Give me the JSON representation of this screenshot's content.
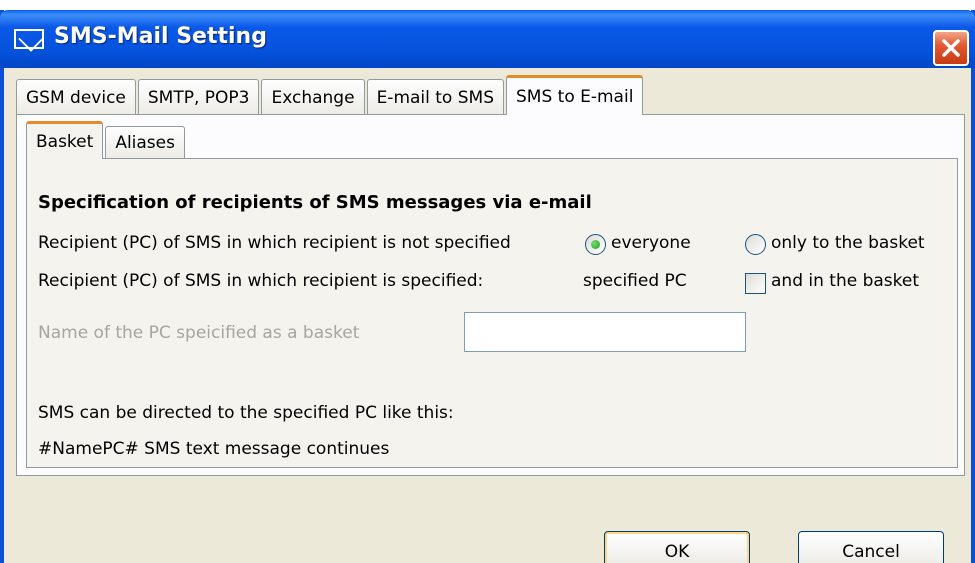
{
  "window": {
    "title": "SMS-Mail Setting",
    "accent_color": "#0a58e8",
    "title_icon": "envelope-icon",
    "close_icon": "close-icon"
  },
  "main_tabs": [
    {
      "label": "GSM device"
    },
    {
      "label": "SMTP, POP3"
    },
    {
      "label": "Exchange"
    },
    {
      "label": "E-mail to SMS"
    },
    {
      "label": "SMS to E-mail",
      "selected": true
    }
  ],
  "sub_tabs": [
    {
      "label": "Basket",
      "selected": true
    },
    {
      "label": "Aliases"
    }
  ],
  "basket": {
    "heading": "Specification of recipients of SMS messages via e-mail",
    "row1_label": "Recipient (PC) of SMS in which recipient is not specified",
    "radio_everyone": {
      "label": "everyone",
      "checked": true
    },
    "radio_basket": {
      "label": "only to the basket",
      "checked": false
    },
    "row2_label": "Recipient (PC) of SMS in which recipient is specified:",
    "row2_value": "specified  PC",
    "check_basket": {
      "label": "and in the basket",
      "checked": false
    },
    "pc_name_label": "Name of the PC speicified as a basket",
    "pc_name_value": "",
    "hint_line1": "SMS can be directed to the specified PC like this:",
    "hint_line2": "#NamePC# SMS text message continues"
  },
  "buttons": {
    "ok": "OK",
    "cancel": "Cancel"
  }
}
